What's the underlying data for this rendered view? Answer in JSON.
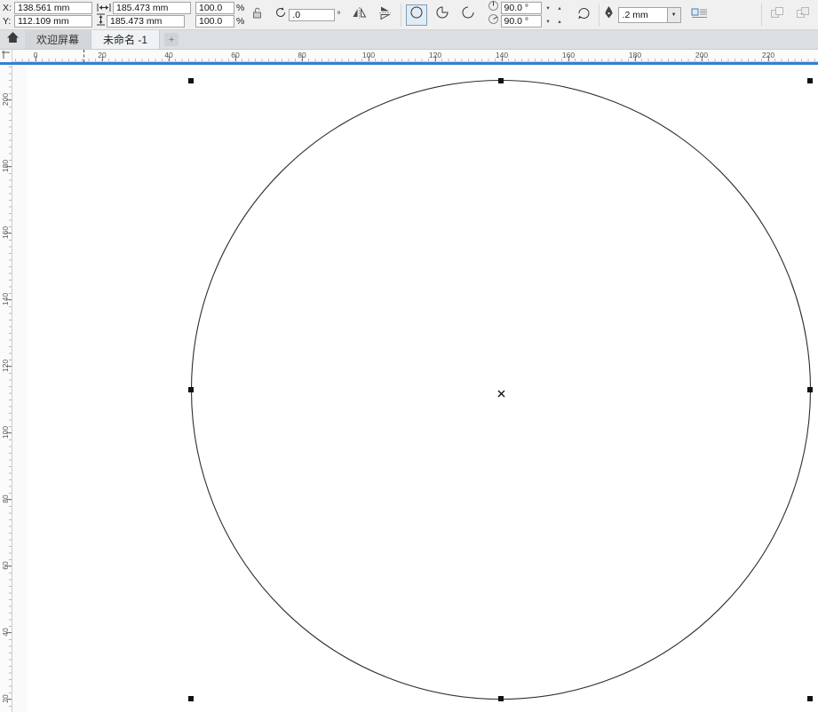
{
  "property_bar": {
    "position": {
      "x_label": "X:",
      "y_label": "Y:",
      "x_value": "138.561 mm",
      "y_value": "112.109 mm"
    },
    "size": {
      "width_value": "185.473 mm",
      "height_value": "185.473 mm"
    },
    "scale": {
      "h_value": "100.0",
      "v_value": "100.0",
      "percent": "%"
    },
    "rotation": {
      "angle_value": ".0",
      "degree": "°"
    },
    "ellipse_modes": {
      "start_angle": "90.0 °",
      "end_angle": "90.0 °"
    },
    "outline_width": ".2 mm",
    "icons": {
      "spinner_up": "▴",
      "spinner_down": "▾",
      "dropdown_arrow": "▼"
    }
  },
  "tab_bar": {
    "welcome_tab": "欢迎屏幕",
    "document_tab": "未命名 -1",
    "new_tab": "+"
  },
  "rulers": {
    "horizontal_labels": [
      "0",
      "20",
      "40",
      "60",
      "80",
      "100",
      "120",
      "140",
      "160",
      "180",
      "200",
      "220"
    ],
    "vertical_labels": [
      "200",
      "180",
      "160",
      "140",
      "120",
      "100",
      "80",
      "60",
      "40",
      "20"
    ]
  },
  "canvas": {
    "selected_object": "ellipse",
    "selection_handle_count": 8
  }
}
